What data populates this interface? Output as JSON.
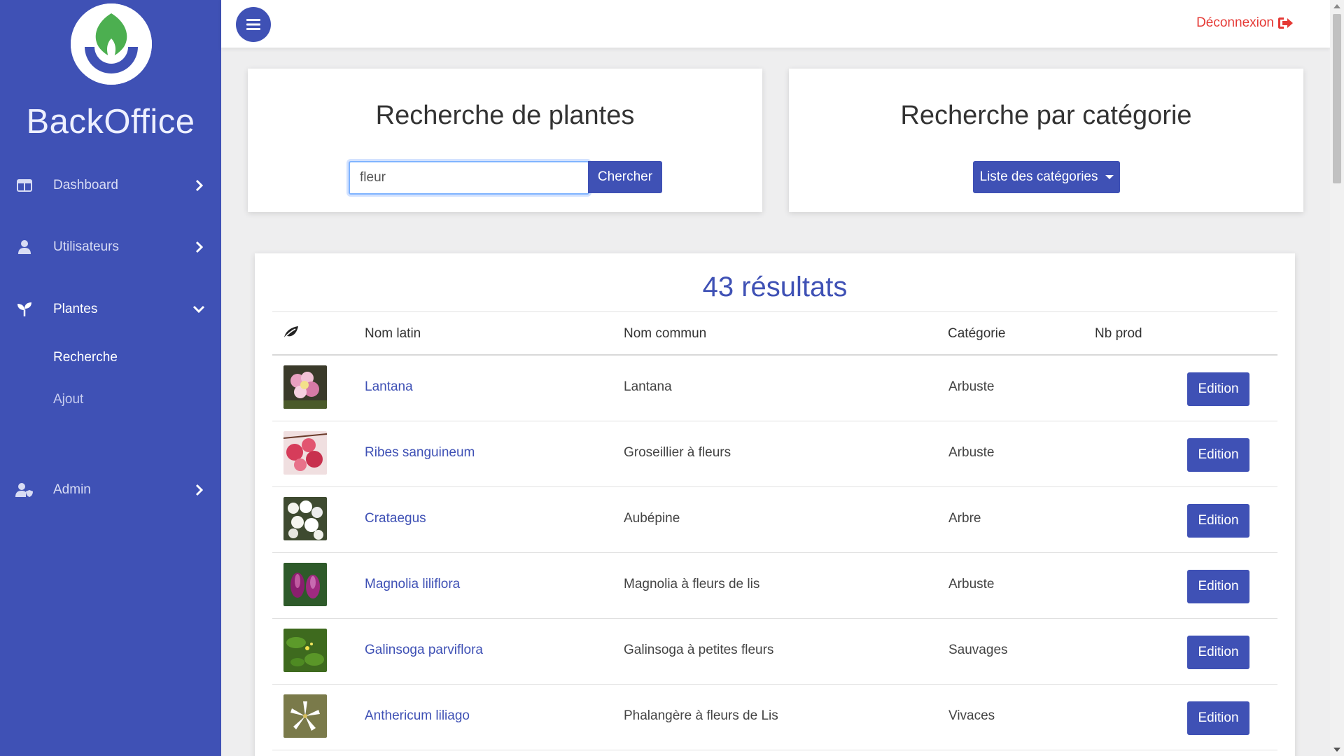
{
  "sidebar": {
    "brand": "BackOffice",
    "items": [
      {
        "label": "Dashboard",
        "icon": "dashboard-icon"
      },
      {
        "label": "Utilisateurs",
        "icon": "user-icon"
      },
      {
        "label": "Plantes",
        "icon": "seedling-icon",
        "expanded": true
      },
      {
        "label": "Admin",
        "icon": "user-shield-icon"
      }
    ],
    "sub_items": [
      {
        "label": "Recherche",
        "active": true
      },
      {
        "label": "Ajout"
      }
    ]
  },
  "topbar": {
    "logout_label": "Déconnexion"
  },
  "search_card": {
    "title": "Recherche de plantes",
    "input_value": "fleur",
    "button_label": "Chercher"
  },
  "category_card": {
    "title": "Recherche par catégorie",
    "dropdown_label": "Liste des catégories"
  },
  "results": {
    "title": "43 résultats",
    "columns": [
      "Nom latin",
      "Nom commun",
      "Catégorie",
      "Nb prod"
    ],
    "rows": [
      {
        "latin": "Lantana",
        "common": "Lantana",
        "category": "Arbuste",
        "nb_prod": "",
        "action": "Edition"
      },
      {
        "latin": "Ribes sanguineum",
        "common": "Groseillier à fleurs",
        "category": "Arbuste",
        "nb_prod": "",
        "action": "Edition"
      },
      {
        "latin": "Crataegus",
        "common": "Aubépine",
        "category": "Arbre",
        "nb_prod": "",
        "action": "Edition"
      },
      {
        "latin": "Magnolia liliflora",
        "common": "Magnolia à fleurs de lis",
        "category": "Arbuste",
        "nb_prod": "",
        "action": "Edition"
      },
      {
        "latin": "Galinsoga parviflora",
        "common": "Galinsoga à petites fleurs",
        "category": "Sauvages",
        "nb_prod": "",
        "action": "Edition"
      },
      {
        "latin": "Anthericum liliago",
        "common": "Phalangère à fleurs de Lis",
        "category": "Vivaces",
        "nb_prod": "",
        "action": "Edition"
      }
    ]
  },
  "colors": {
    "primary": "#3f51b5",
    "logout": "#e53935",
    "background": "#eeeeef"
  }
}
